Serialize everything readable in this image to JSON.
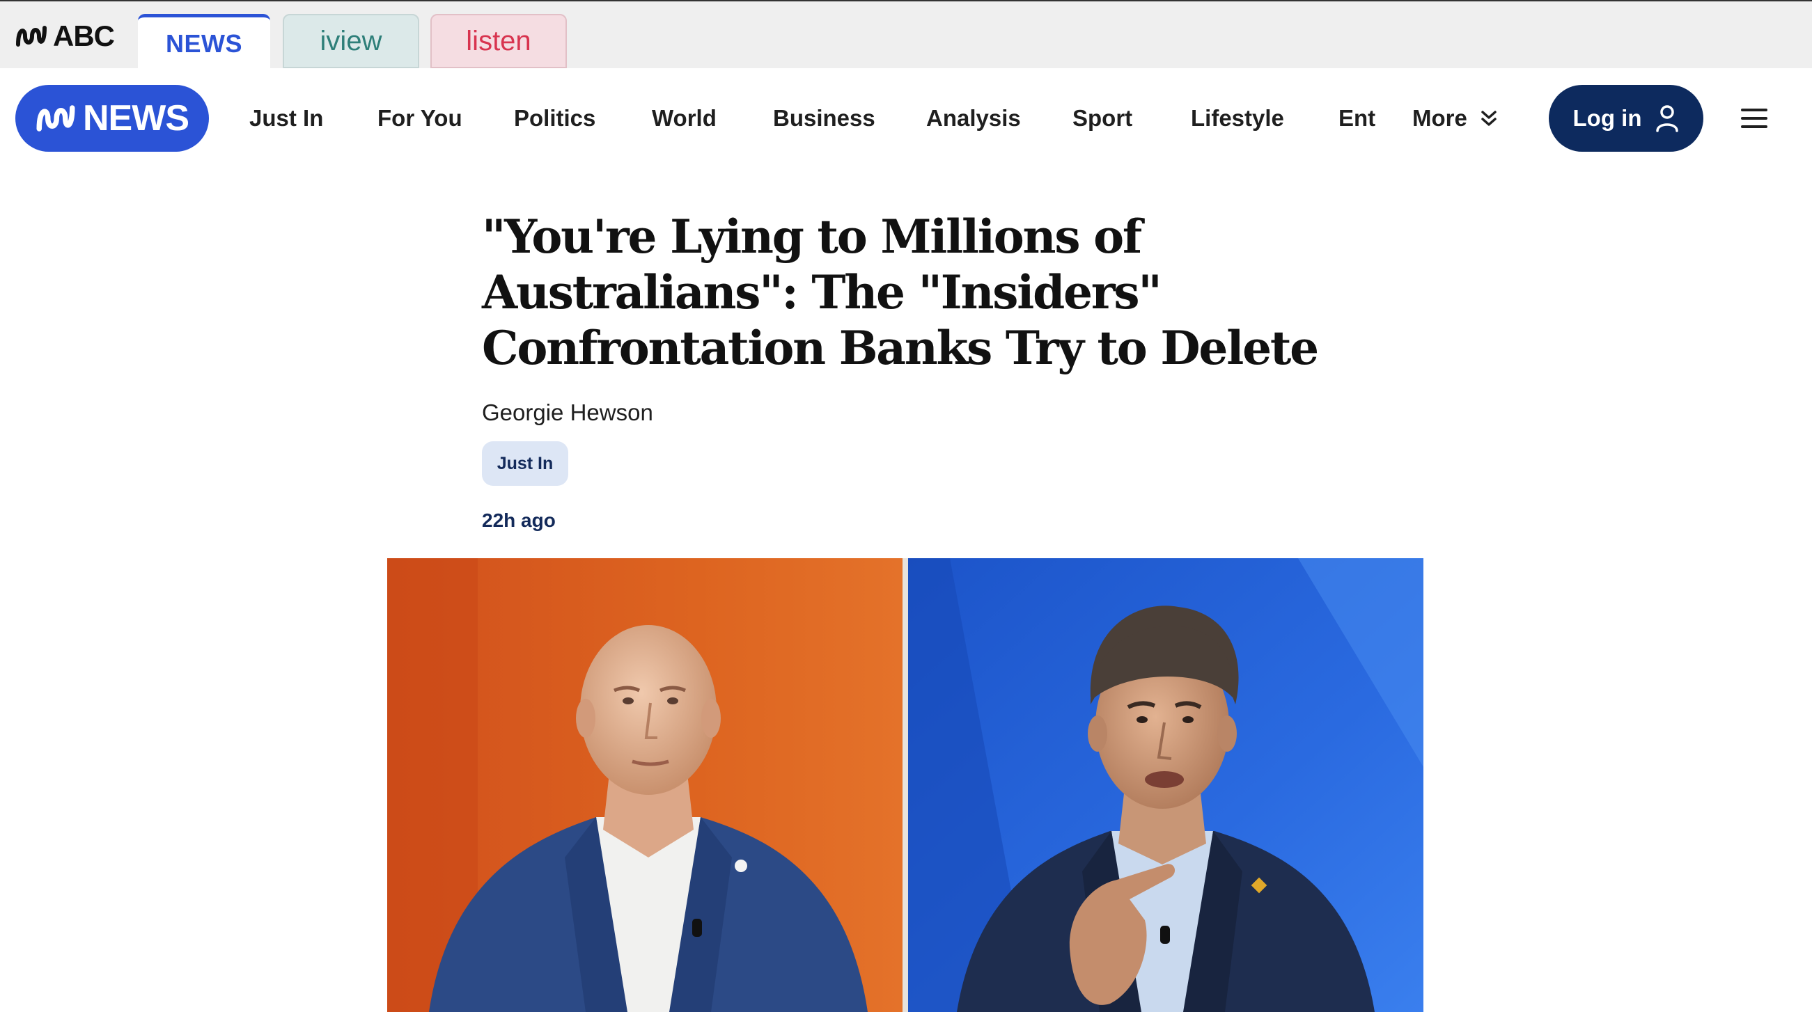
{
  "network_bar": {
    "brand": "ABC",
    "tabs": [
      {
        "label": "NEWS",
        "active": true
      },
      {
        "label": "iview",
        "active": false
      },
      {
        "label": "listen",
        "active": false
      }
    ]
  },
  "main_nav": {
    "logo_text": "NEWS",
    "links": [
      "Just In",
      "For You",
      "Politics",
      "World",
      "Business",
      "Analysis",
      "Sport",
      "Lifestyle"
    ],
    "clipped_link": "Ent",
    "more_label": "More",
    "login_label": "Log in",
    "icons": {
      "more": "chevron-double-down-icon",
      "login": "user-icon",
      "menu": "hamburger-menu-icon"
    }
  },
  "article": {
    "headline": "\"You're Lying to Millions of Australians\": The \"Insiders\" Confrontation Banks Try to Delete",
    "author": "Georgie Hewson",
    "tag": "Just In",
    "timestamp": "22h ago"
  },
  "colors": {
    "brand_blue": "#2b53d6",
    "navy": "#0d2a5e",
    "iview_teal": "#2e7f79",
    "listen_red": "#d8344f",
    "tag_bg": "#dde6f5"
  }
}
